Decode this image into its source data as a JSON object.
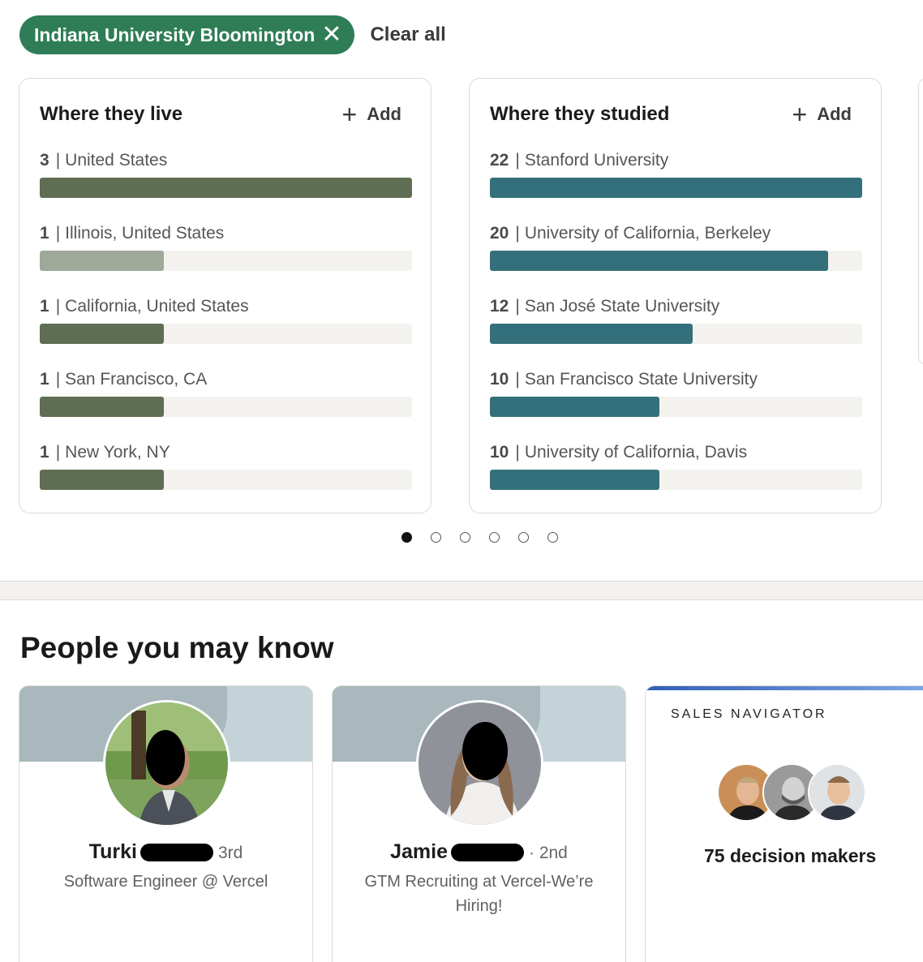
{
  "filter": {
    "chip_label": "Indiana University Bloomington",
    "chip_close": "✕",
    "clear_all": "Clear all"
  },
  "cards": {
    "live": {
      "title": "Where they live",
      "add": "Add",
      "rows": [
        {
          "count": "3",
          "label": "United States",
          "fraction": 1.0
        },
        {
          "count": "1",
          "label": "Illinois, United States",
          "fraction": 0.333
        },
        {
          "count": "1",
          "label": "California, United States",
          "fraction": 0.333
        },
        {
          "count": "1",
          "label": "San Francisco, CA",
          "fraction": 0.333
        },
        {
          "count": "1",
          "label": "New York, NY",
          "fraction": 0.333
        }
      ]
    },
    "studied": {
      "title": "Where they studied",
      "add": "Add",
      "rows": [
        {
          "count": "22",
          "label": "Stanford University",
          "fraction": 1.0
        },
        {
          "count": "20",
          "label": "University of California, Berkeley",
          "fraction": 0.909
        },
        {
          "count": "12",
          "label": "San José State University",
          "fraction": 0.545
        },
        {
          "count": "10",
          "label": "San Francisco State University",
          "fraction": 0.455
        },
        {
          "count": "10",
          "label": "University of California, Davis",
          "fraction": 0.455
        }
      ]
    }
  },
  "colors": {
    "chip": "#2e7d57",
    "live_bar": "#5f6e53",
    "live_bar_light": "#9ea999",
    "studied_bar": "#34707b",
    "track": "#f3f2ef"
  },
  "pagination": {
    "total": 6,
    "active_index": 0
  },
  "people": {
    "section_title": "People you may know",
    "cards": [
      {
        "first_name": "Turki",
        "degree": "3rd",
        "headline": "Software Engineer @ Vercel"
      },
      {
        "first_name": "Jamie",
        "degree": "· 2nd",
        "headline": "GTM Recruiting at Vercel-We’re Hiring!"
      }
    ],
    "sales": {
      "brand": "SALES NAVIGATOR",
      "decision_makers": "75 decision makers"
    }
  }
}
